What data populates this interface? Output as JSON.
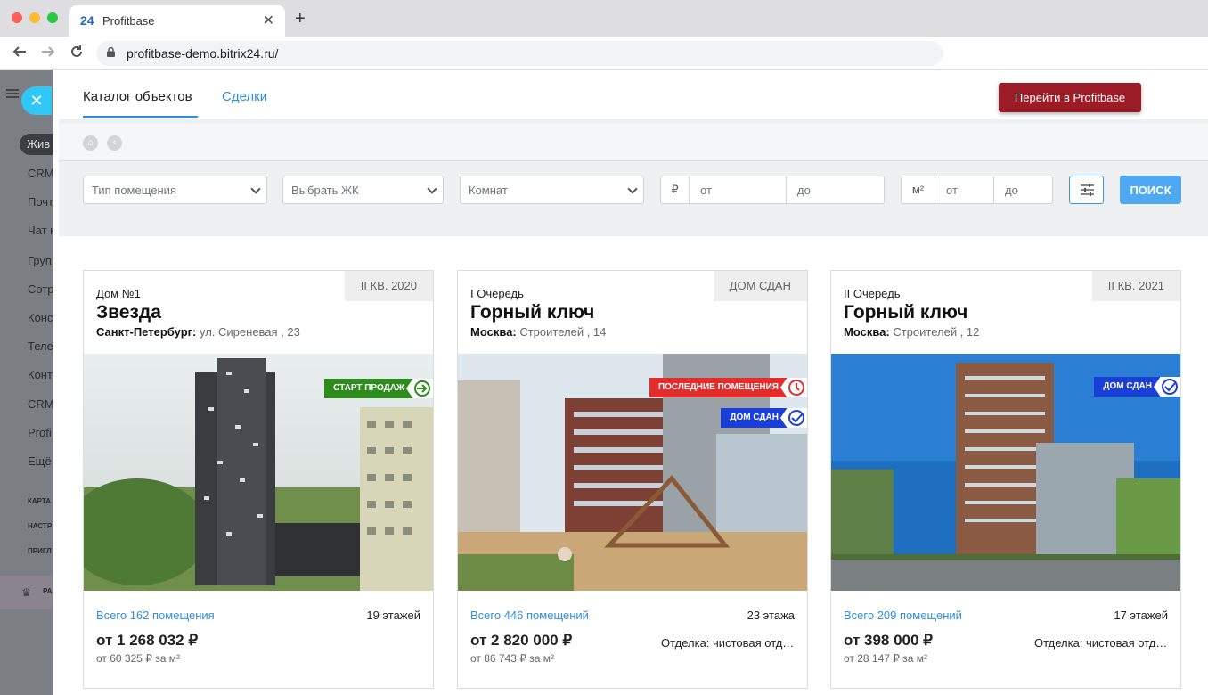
{
  "browser": {
    "tab_logo": "24",
    "tab_title": "Profitbase",
    "tab_close": "✕",
    "new_tab": "+",
    "url": "profitbase-demo.bitrix24.ru/"
  },
  "bx_sidebar": {
    "items": [
      "Жив",
      "CRM",
      "Почт",
      "Чат н",
      "Груп",
      "Сотр",
      "Конс",
      "Теле",
      "Конт",
      "CRM",
      "Profi",
      "Ещё"
    ],
    "small_items": [
      "КАРТА",
      "НАСТР",
      "ПРИГЛ"
    ],
    "bottom_label": "РА"
  },
  "panel": {
    "tabs": [
      {
        "label": "Каталог объектов",
        "active": true
      },
      {
        "label": "Сделки",
        "active": false
      }
    ],
    "go_button": "Перейти в Profitbase"
  },
  "filters": {
    "type": "Тип помещения",
    "complex": "Выбрать ЖК",
    "rooms": "Комнат",
    "price_unit": "₽",
    "price_from": "от",
    "price_to": "до",
    "area_unit": "м²",
    "area_from": "от",
    "area_to": "до",
    "search": "ПОИСК"
  },
  "colors": {
    "accent": "#2f8ee0",
    "go_button": "#9b1c26",
    "badge_green": "#2e8b1e",
    "badge_red": "#e32c2c",
    "badge_blue": "#1a3fd6"
  },
  "cards": [
    {
      "deadline": "II КВ. 2020",
      "subtitle": "Дом №1",
      "name": "Звезда",
      "city": "Санкт-Петербург:",
      "street": "ул. Сиреневая , 23",
      "badges": [
        {
          "label": "СТАРТ ПРОДАЖ",
          "icon": "arrow-circle-icon"
        }
      ],
      "rooms": "Всего 162 помещения",
      "floors": "19 этажей",
      "price": "от 1 268 032 ₽",
      "finish": "",
      "price_per_m2": "от 60 325 ₽ за м²"
    },
    {
      "deadline": "ДОМ СДАН",
      "subtitle": "I Очередь",
      "name": "Горный ключ",
      "city": "Москва:",
      "street": "Строителей , 14",
      "badges": [
        {
          "label": "ПОСЛЕДНИЕ ПОМЕЩЕНИЯ",
          "icon": "clock-icon"
        },
        {
          "label": "ДОМ СДАН",
          "icon": "check-circle-icon"
        }
      ],
      "rooms": "Всего 446 помещений",
      "floors": "23 этажа",
      "price": "от 2 820 000 ₽",
      "finish": "Отделка: чистовая отделка",
      "price_per_m2": "от 86 743 ₽ за м²"
    },
    {
      "deadline": "II КВ. 2021",
      "subtitle": "II Очередь",
      "name": "Горный ключ",
      "city": "Москва:",
      "street": "Строителей , 12",
      "badges": [
        {
          "label": "ДОМ СДАН",
          "icon": "check-circle-icon"
        }
      ],
      "rooms": "Всего 209 помещений",
      "floors": "17 этажей",
      "price": "от 398 000 ₽",
      "finish": "Отделка: чистовая отделка",
      "price_per_m2": "от 28 147 ₽ за м²"
    }
  ]
}
